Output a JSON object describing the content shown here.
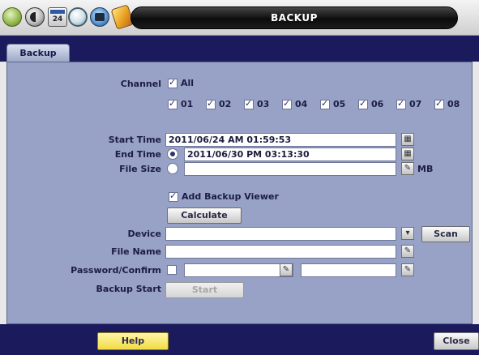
{
  "window": {
    "title": "BACKUP"
  },
  "toolbar": {
    "icons": [
      "system-icon",
      "record-icon",
      "schedule-calendar-icon",
      "network-icon",
      "backup-disc-icon",
      "tools-icon"
    ],
    "calendar_day": "24"
  },
  "tabs": [
    {
      "label": "Backup",
      "active": true
    }
  ],
  "form": {
    "channel": {
      "label": "Channel",
      "all": {
        "label": "All",
        "checked": true
      },
      "channels": [
        {
          "label": "01",
          "checked": true
        },
        {
          "label": "02",
          "checked": true
        },
        {
          "label": "03",
          "checked": true
        },
        {
          "label": "04",
          "checked": true
        },
        {
          "label": "05",
          "checked": true
        },
        {
          "label": "06",
          "checked": true
        },
        {
          "label": "07",
          "checked": true
        },
        {
          "label": "08",
          "checked": true
        }
      ]
    },
    "start_time": {
      "label": "Start Time",
      "value": "2011/06/24 AM 01:59:53"
    },
    "end_time": {
      "label": "End Time",
      "value": "2011/06/30 PM 03:13:30",
      "selected": true
    },
    "file_size": {
      "label": "File Size",
      "value": "",
      "unit": "MB",
      "selected": false
    },
    "add_backup_viewer": {
      "label": "Add Backup Viewer",
      "checked": true
    },
    "calculate_label": "Calculate",
    "device": {
      "label": "Device",
      "value": ""
    },
    "scan_label": "Scan",
    "file_name": {
      "label": "File Name",
      "value": ""
    },
    "password_confirm": {
      "label": "Password/Confirm",
      "checked": false,
      "password": "",
      "confirm": ""
    },
    "backup_start": {
      "label": "Backup Start",
      "button_label": "Start"
    }
  },
  "footer": {
    "help_label": "Help",
    "close_label": "Close"
  },
  "colors": {
    "frame_navy": "#1a1a5c",
    "panel": "#97a2c6",
    "title_bar": "#111111",
    "help_yellow": "#f1dc43"
  }
}
